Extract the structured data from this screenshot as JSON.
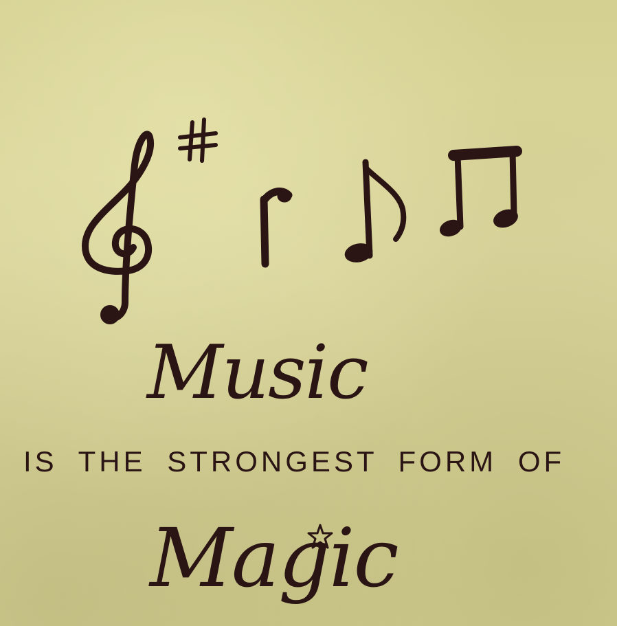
{
  "note": {
    "word_1": "Music",
    "line_2": "IS THE STRONGEST FORM OF",
    "word_3": "Magic"
  },
  "colors": {
    "paper": "#d9d59a",
    "ink": "#2a1414"
  },
  "symbols": [
    "treble-clef",
    "sharp",
    "quarter-rest",
    "eighth-note",
    "beamed-eighth-notes",
    "star"
  ]
}
